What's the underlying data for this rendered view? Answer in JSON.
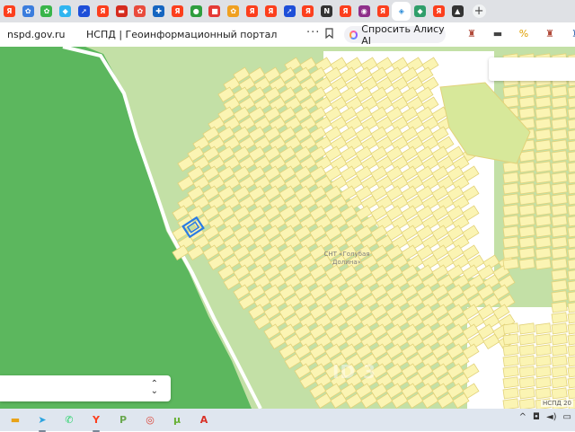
{
  "browser": {
    "tabs": [
      {
        "icon": "yandex-icon",
        "glyph": "Я",
        "color": "#fc3f1d"
      },
      {
        "icon": "apps-icon",
        "glyph": "✿",
        "color": "#3b7ddd"
      },
      {
        "icon": "apps-icon",
        "glyph": "✿",
        "color": "#39b54a"
      },
      {
        "icon": "avito-icon",
        "glyph": "◆",
        "color": "#2fb5f0"
      },
      {
        "icon": "arrow-logo-icon",
        "glyph": "➚",
        "color": "#1e4fd8"
      },
      {
        "icon": "yandex-icon",
        "glyph": "Я",
        "color": "#fc3f1d"
      },
      {
        "icon": "russia-flag-icon",
        "glyph": "▬",
        "color": "#d52b1e"
      },
      {
        "icon": "apps-icon",
        "glyph": "✿",
        "color": "#e94b3c"
      },
      {
        "icon": "medical-cross-icon",
        "glyph": "✚",
        "color": "#1565c0"
      },
      {
        "icon": "yandex-icon",
        "glyph": "Я",
        "color": "#fc3f1d"
      },
      {
        "icon": "green-circle-icon",
        "glyph": "●",
        "color": "#2e9e3e"
      },
      {
        "icon": "red-message-icon",
        "glyph": "■",
        "color": "#e53935"
      },
      {
        "icon": "apps-icon",
        "glyph": "✿",
        "color": "#f0a020"
      },
      {
        "icon": "yandex-icon",
        "glyph": "Я",
        "color": "#fc3f1d"
      },
      {
        "icon": "yandex-icon",
        "glyph": "Я",
        "color": "#fc3f1d"
      },
      {
        "icon": "arrow-logo-icon",
        "glyph": "➚",
        "color": "#1e4fd8"
      },
      {
        "icon": "yandex-icon",
        "glyph": "Я",
        "color": "#fc3f1d"
      },
      {
        "icon": "notion-icon",
        "glyph": "N",
        "color": "#333333"
      },
      {
        "icon": "yandex-icon",
        "glyph": "Я",
        "color": "#fc3f1d"
      },
      {
        "icon": "emblem-icon",
        "glyph": "◉",
        "color": "#8e2f8a"
      },
      {
        "icon": "yandex-icon",
        "glyph": "Я",
        "color": "#fc3f1d"
      },
      {
        "icon": "map-portal-icon",
        "glyph": "◈",
        "color": "#2a8bd8",
        "active": true
      },
      {
        "icon": "green-map-icon",
        "glyph": "◆",
        "color": "#2f9e6a"
      },
      {
        "icon": "yandex-icon",
        "glyph": "Я",
        "color": "#fc3f1d"
      },
      {
        "icon": "photo-icon",
        "glyph": "▲",
        "color": "#333333"
      }
    ],
    "new_tab_label": "+",
    "domain": "nspd.gov.ru",
    "page_title": "НСПД | Геоинформационный портал",
    "more_label": "···",
    "alice_label": "Спросить Алису AI",
    "extensions": [
      {
        "icon": "extension-icon-1",
        "glyph": "♜",
        "color": "#b14a3a"
      },
      {
        "icon": "extension-icon-2",
        "glyph": "▬",
        "color": "#444444"
      },
      {
        "icon": "percent-icon",
        "glyph": "%",
        "color": "#e0a000"
      },
      {
        "icon": "extension-icon-3",
        "glyph": "♜",
        "color": "#b14a3a"
      },
      {
        "icon": "extension-icon-4",
        "glyph": "♜",
        "color": "#3a6db1"
      }
    ]
  },
  "map": {
    "settlement_label_line1": "СНТ «Голубая",
    "settlement_label_line2": "Долина»",
    "watermark": "ID 3",
    "attribution": "НСПД 20",
    "layer_select_arrows": "⌃⌄",
    "colors": {
      "forest": "#5cb75e",
      "meadow": "#c3e0a6",
      "parcel_fill": "#fbf4b3",
      "parcel_line": "#e2d27a",
      "selected_parcel": "#2a7be4"
    }
  },
  "taskbar": {
    "apps": [
      {
        "icon": "folder-icon",
        "glyph": "▬",
        "color": "#e8a317"
      },
      {
        "icon": "telegram-icon",
        "glyph": "➤",
        "color": "#2aa3df",
        "running": true
      },
      {
        "icon": "whatsapp-icon",
        "glyph": "✆",
        "color": "#25d366"
      },
      {
        "icon": "yandex-browser-icon",
        "glyph": "Y",
        "color": "#fc3f1d",
        "running": true
      },
      {
        "icon": "p-app-icon",
        "glyph": "P",
        "color": "#6aa84f"
      },
      {
        "icon": "chrome-icon",
        "glyph": "◎",
        "color": "#db4437"
      },
      {
        "icon": "utorrent-icon",
        "glyph": "μ",
        "color": "#66b033"
      },
      {
        "icon": "pdf-icon",
        "glyph": "A",
        "color": "#d93025"
      }
    ],
    "tray": {
      "chevron": "^",
      "network": "◘",
      "volume": "◄)",
      "battery": "▭"
    }
  }
}
